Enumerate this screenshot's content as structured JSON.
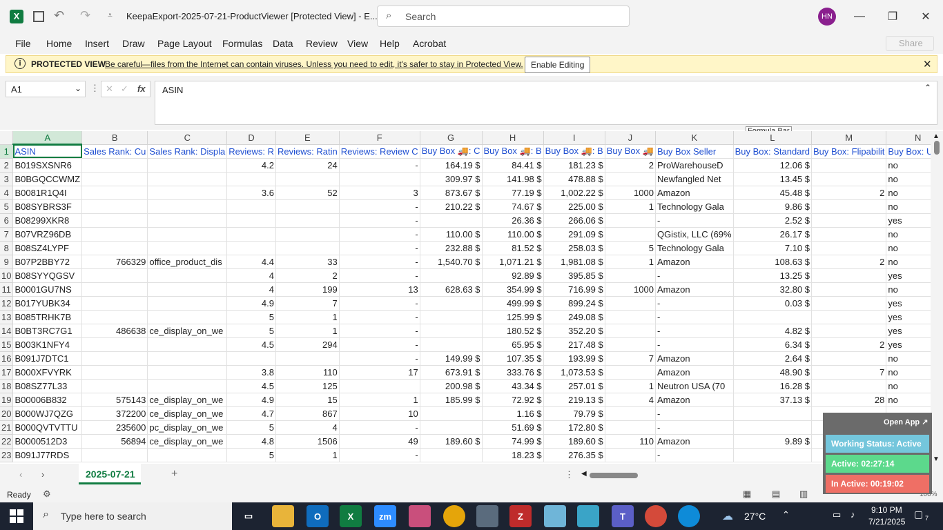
{
  "window": {
    "title": "KeepaExport-2025-07-21-ProductViewer  [Protected View]  -  E...",
    "search_placeholder": "Search",
    "user_initials": "HN",
    "share_label": "Share"
  },
  "menu": [
    "File",
    "Home",
    "Insert",
    "Draw",
    "Page Layout",
    "Formulas",
    "Data",
    "Review",
    "View",
    "Help",
    "Acrobat"
  ],
  "protected_view": {
    "label": "PROTECTED VIEW",
    "message": "Be careful—files from the Internet can contain viruses. Unless you need to edit, it's safer to stay in Protected View.",
    "button": "Enable Editing"
  },
  "formula_bar": {
    "name_box": "A1",
    "fx": "fx",
    "content": "ASIN",
    "tooltip": "Formula Bar"
  },
  "sheet": {
    "columns": [
      "A",
      "B",
      "C",
      "D",
      "E",
      "F",
      "G",
      "H",
      "I",
      "J",
      "K",
      "L",
      "M",
      "N"
    ],
    "header_row": [
      "ASIN",
      "Sales Rank: Cu",
      "Sales Rank: Displa",
      "Reviews: R",
      "Reviews: Ratin",
      "Reviews: Review C",
      "Buy Box 🚚: C",
      "Buy Box 🚚: B",
      "Buy Box 🚚: B",
      "Buy Box 🚚",
      "Buy Box Seller",
      "Buy Box: Standard",
      "Buy Box: Flipabilit",
      "Buy Box: Unqu"
    ],
    "rows": [
      [
        "B019SXSNR6",
        "",
        "",
        "4.2",
        "24",
        "-",
        "164.19 $",
        "84.41 $",
        "181.23 $",
        "2",
        "ProWarehouseD",
        "12.06 $",
        "",
        "no"
      ],
      [
        "B0BGQCCWMZ",
        "",
        "",
        "",
        "",
        "",
        "309.97 $",
        "141.98 $",
        "478.88 $",
        "",
        "Newfangled Net",
        "13.45 $",
        "",
        "no"
      ],
      [
        "B0081R1Q4I",
        "",
        "",
        "3.6",
        "52",
        "3",
        "873.67 $",
        "77.19 $",
        "1,002.22 $",
        "1000",
        "Amazon",
        "45.48 $",
        "2",
        "no"
      ],
      [
        "B08SYBRS3F",
        "",
        "",
        "",
        "",
        "-",
        "210.22 $",
        "74.67 $",
        "225.00 $",
        "1",
        "Technology Gala",
        "9.86 $",
        "",
        "no"
      ],
      [
        "B08299XKR8",
        "",
        "",
        "",
        "",
        "-",
        "",
        "26.36 $",
        "266.06 $",
        "",
        "-",
        "2.52 $",
        "",
        "yes"
      ],
      [
        "B07VRZ96DB",
        "",
        "",
        "",
        "",
        "-",
        "110.00 $",
        "110.00 $",
        "291.09 $",
        "",
        "QGistix, LLC (69%",
        "26.17 $",
        "",
        "no"
      ],
      [
        "B08SZ4LYPF",
        "",
        "",
        "",
        "",
        "-",
        "232.88 $",
        "81.52 $",
        "258.03 $",
        "5",
        "Technology Gala",
        "7.10 $",
        "",
        "no"
      ],
      [
        "B07P2BBY72",
        "766329",
        "office_product_dis",
        "4.4",
        "33",
        "-",
        "1,540.70 $",
        "1,071.21 $",
        "1,981.08 $",
        "1",
        "Amazon",
        "108.63 $",
        "2",
        "no"
      ],
      [
        "B08SYYQGSV",
        "",
        "",
        "4",
        "2",
        "-",
        "",
        "92.89 $",
        "395.85 $",
        "",
        "-",
        "13.25 $",
        "",
        "yes"
      ],
      [
        "B0001GU7NS",
        "",
        "",
        "4",
        "199",
        "13",
        "628.63 $",
        "354.99 $",
        "716.99 $",
        "1000",
        "Amazon",
        "32.80 $",
        "",
        "no"
      ],
      [
        "B017YUBK34",
        "",
        "",
        "4.9",
        "7",
        "-",
        "",
        "499.99 $",
        "899.24 $",
        "",
        "-",
        "0.03 $",
        "",
        "yes"
      ],
      [
        "B085TRHK7B",
        "",
        "",
        "5",
        "1",
        "-",
        "",
        "125.99 $",
        "249.08 $",
        "",
        "-",
        "",
        "",
        "yes"
      ],
      [
        "B0BT3RC7G1",
        "486638",
        "ce_display_on_we",
        "5",
        "1",
        "-",
        "",
        "180.52 $",
        "352.20 $",
        "",
        "-",
        "4.82 $",
        "",
        "yes"
      ],
      [
        "B003K1NFY4",
        "",
        "",
        "4.5",
        "294",
        "-",
        "",
        "65.95 $",
        "217.48 $",
        "",
        "-",
        "6.34 $",
        "2",
        "yes"
      ],
      [
        "B091J7DTC1",
        "",
        "",
        "",
        "",
        "-",
        "149.99 $",
        "107.35 $",
        "193.99 $",
        "7",
        "Amazon",
        "2.64 $",
        "",
        "no"
      ],
      [
        "B000XFVYRK",
        "",
        "",
        "3.8",
        "110",
        "17",
        "673.91 $",
        "333.76 $",
        "1,073.53 $",
        "",
        "Amazon",
        "48.90 $",
        "7",
        "no"
      ],
      [
        "B08SZ77L33",
        "",
        "",
        "4.5",
        "125",
        "",
        "200.98 $",
        "43.34 $",
        "257.01 $",
        "1",
        "Neutron USA (70",
        "16.28 $",
        "",
        "no"
      ],
      [
        "B00006B832",
        "575143",
        "ce_display_on_we",
        "4.9",
        "15",
        "1",
        "185.99 $",
        "72.92 $",
        "219.13 $",
        "4",
        "Amazon",
        "37.13 $",
        "28",
        "no"
      ],
      [
        "B000WJ7QZG",
        "372200",
        "ce_display_on_we",
        "4.7",
        "867",
        "10",
        "",
        "1.16 $",
        "79.79 $",
        "",
        "-",
        "",
        "",
        ""
      ],
      [
        "B000QVTVTTU",
        "235600",
        "pc_display_on_we",
        "5",
        "4",
        "-",
        "",
        "51.69 $",
        "172.80 $",
        "",
        "-",
        "",
        "",
        "yes"
      ],
      [
        "B0000512D3",
        "56894",
        "ce_display_on_we",
        "4.8",
        "1506",
        "49",
        "189.60 $",
        "74.99 $",
        "189.60 $",
        "110",
        "Amazon",
        "9.89 $",
        "",
        ""
      ],
      [
        "B091J77RDS",
        "",
        "",
        "5",
        "1",
        "-",
        "",
        "18.23 $",
        "276.35 $",
        "",
        "-",
        "",
        "",
        ""
      ]
    ],
    "tab": "2025-07-21"
  },
  "status": {
    "ready": "Ready",
    "zoom": "100%"
  },
  "widget": {
    "open_app": "Open App ↗",
    "working": "Working Status: Active",
    "active": "Active: 02:27:14",
    "inactive": "In Active: 00:19:02"
  },
  "taskbar": {
    "search_placeholder": "Type here to search",
    "weather": "27°C",
    "time": "9:10 PM",
    "date": "7/21/2025",
    "notifications": "7"
  },
  "colors": {
    "excel_green": "#107c41",
    "header_blue": "#1f4fd1",
    "widget_active": "#5cd98c",
    "widget_inactive": "#ef6f65",
    "widget_status": "#74c6dc"
  }
}
